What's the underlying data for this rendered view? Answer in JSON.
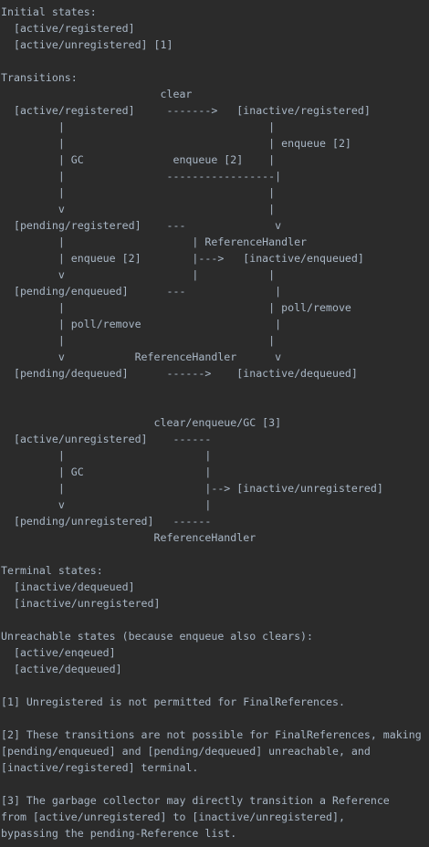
{
  "code": {
    "lines": [
      "Initial states:",
      "  [active/registered]",
      "  [active/unregistered] [1]",
      "",
      "Transitions:",
      "                         clear",
      "  [active/registered]     ------->   [inactive/registered]",
      "         |                                |",
      "         |                                | enqueue [2]",
      "         | GC              enqueue [2]    |",
      "         |                -----------------|",
      "         |                                |",
      "         v                                |",
      "  [pending/registered]    ---              v",
      "         |                    | ReferenceHandler",
      "         | enqueue [2]        |--->   [inactive/enqueued]",
      "         v                    |           |",
      "  [pending/enqueued]      ---              |",
      "         |                                | poll/remove",
      "         | poll/remove                     |",
      "         |                                |",
      "         v           ReferenceHandler      v",
      "  [pending/dequeued]      ------>    [inactive/dequeued]",
      "",
      "",
      "                        clear/enqueue/GC [3]",
      "  [active/unregistered]    ------",
      "         |                      |",
      "         | GC                   |",
      "         |                      |--> [inactive/unregistered]",
      "         v                      |",
      "  [pending/unregistered]   ------",
      "                        ReferenceHandler",
      "",
      "Terminal states:",
      "  [inactive/dequeued]",
      "  [inactive/unregistered]",
      "",
      "Unreachable states (because enqueue also clears):",
      "  [active/enqeued]",
      "  [active/dequeued]",
      "",
      "[1] Unregistered is not permitted for FinalReferences.",
      "",
      "[2] These transitions are not possible for FinalReferences, making",
      "[pending/enqueued] and [pending/dequeued] unreachable, and",
      "[inactive/registered] terminal.",
      "",
      "[3] The garbage collector may directly transition a Reference",
      "from [active/unregistered] to [inactive/unregistered],",
      "bypassing the pending-Reference list."
    ]
  },
  "colors": {
    "background": "#2b2b2b",
    "text": "#a9b7c6"
  }
}
